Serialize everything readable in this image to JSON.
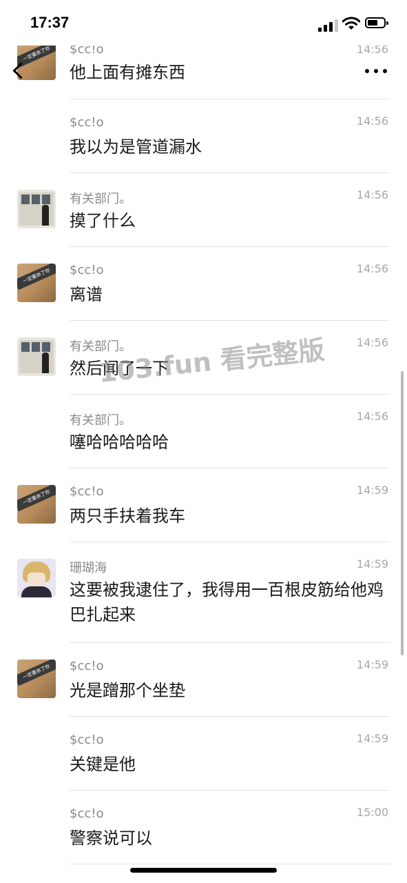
{
  "status": {
    "time": "17:37"
  },
  "messages": [
    {
      "name": "$cc!o",
      "time": "14:56",
      "text": "他上面有摊东西",
      "avatar": "dog-sign"
    },
    {
      "name": "$cc!o",
      "time": "14:56",
      "text": "我以为是管道漏水",
      "avatar": ""
    },
    {
      "name": "有关部门。",
      "time": "14:56",
      "text": "摸了什么",
      "avatar": "window-person"
    },
    {
      "name": "$cc!o",
      "time": "14:56",
      "text": "离谱",
      "avatar": "dog-sign"
    },
    {
      "name": "有关部门。",
      "time": "14:56",
      "text": "然后闻了一下",
      "avatar": "window-person"
    },
    {
      "name": "有关部门。",
      "time": "14:56",
      "text": "噻哈哈哈哈哈",
      "avatar": ""
    },
    {
      "name": "$cc!o",
      "time": "14:59",
      "text": "两只手扶着我车",
      "avatar": "dog-sign"
    },
    {
      "name": "珊瑚海",
      "time": "14:59",
      "text": "这要被我逮住了，我得用一百根皮筋给他鸡巴扎起来",
      "avatar": "anime-boy"
    },
    {
      "name": "$cc!o",
      "time": "14:59",
      "text": "光是蹭那个坐垫",
      "avatar": "dog-sign"
    },
    {
      "name": "$cc!o",
      "time": "14:59",
      "text": "关键是他",
      "avatar": ""
    },
    {
      "name": "$cc!o",
      "time": "15:00",
      "text": "警察说可以",
      "avatar": ""
    }
  ],
  "watermark": "103.fun 看完整版",
  "avatar_sign_text": "一定要杀了你"
}
